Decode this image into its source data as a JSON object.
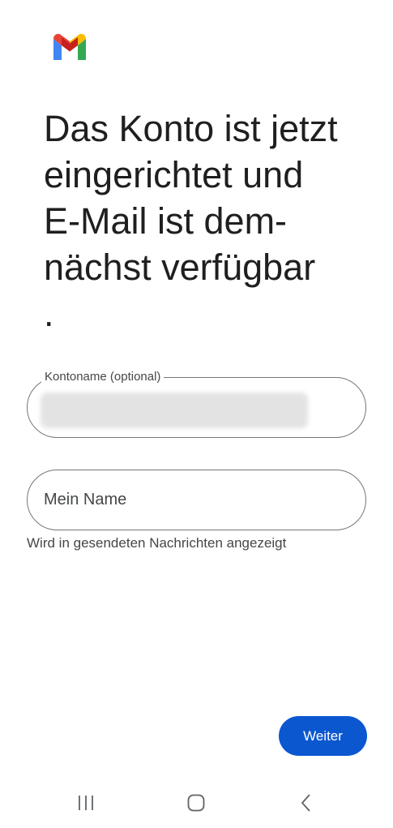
{
  "app": {
    "logo_icon": "gmail-logo-icon",
    "colors": {
      "blue": "#4285F4",
      "red": "#EA4335",
      "yellow": "#FBBC04",
      "green": "#34A853",
      "accent": "#0b57d0"
    }
  },
  "page": {
    "title": "Das Konto ist jetzt\neingerichtet und\nE-Mail ist dem-\nnächst verfügbar\n."
  },
  "form": {
    "account_name": {
      "label": "Kontoname (optional)",
      "value_redacted": true
    },
    "your_name": {
      "placeholder": "Mein Name",
      "helper": "Wird in gesendeten Nachrichten angezeigt"
    }
  },
  "actions": {
    "next_label": "Weiter"
  },
  "navbar": {
    "items": [
      {
        "icon": "recent-apps-icon"
      },
      {
        "icon": "home-icon"
      },
      {
        "icon": "back-icon"
      }
    ]
  }
}
